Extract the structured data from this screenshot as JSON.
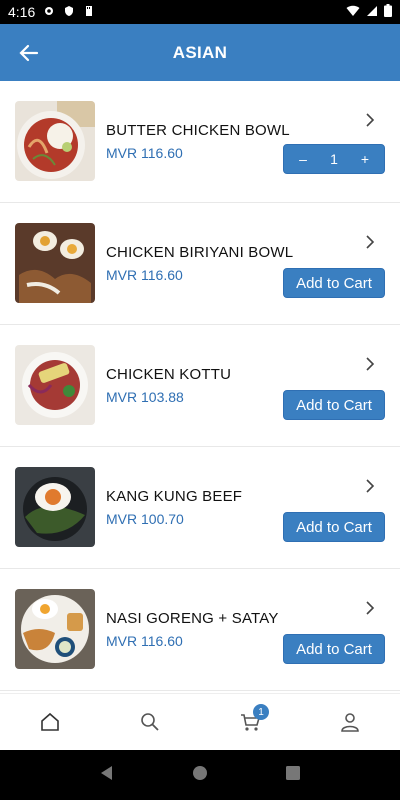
{
  "status": {
    "time": "4:16"
  },
  "app_bar": {
    "title": "ASIAN"
  },
  "items": [
    {
      "name": "BUTTER CHICKEN BOWL",
      "price": "MVR 116.60",
      "qty": "1"
    },
    {
      "name": "CHICKEN BIRIYANI BOWL",
      "price": "MVR 116.60",
      "button": "Add to Cart"
    },
    {
      "name": "CHICKEN KOTTU",
      "price": "MVR 103.88",
      "button": "Add to Cart"
    },
    {
      "name": "KANG KUNG BEEF",
      "price": "MVR 100.70",
      "button": "Add to Cart"
    },
    {
      "name": "NASI GORENG + SATAY",
      "price": "MVR 116.60",
      "button": "Add to Cart"
    }
  ],
  "stepper": {
    "minus": "–",
    "plus": "+"
  },
  "bottom_nav": {
    "cart_badge": "1"
  },
  "colors": {
    "primary": "#3a7fc1",
    "price": "#2f6fb3"
  }
}
